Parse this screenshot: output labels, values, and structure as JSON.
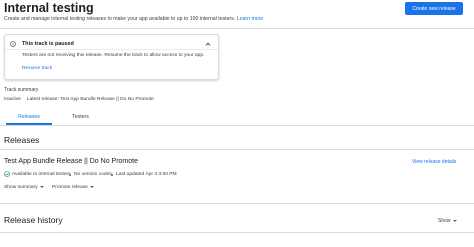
{
  "header": {
    "title": "Internal testing",
    "subtitle_text": "Create and manage internal testing releases to make your app available to up to 100 internal testers.",
    "subtitle_link": "Learn more",
    "primary_button": "Create new release"
  },
  "paused_card": {
    "title": "This track is paused",
    "body": "Testers are not receiving this release. Resume the track to allow access to your app.",
    "action": "Resume track"
  },
  "track_summary": {
    "label": "Track summary",
    "status": "Inactive",
    "latest_release": "Latest release: Test App Bundle Release || Do No Promote"
  },
  "tabs": [
    {
      "label": "Releases",
      "active": true
    },
    {
      "label": "Testers",
      "active": false
    }
  ],
  "releases": {
    "heading": "Releases",
    "release_title": "Test App Bundle Release || Do No Promote",
    "view_details": "View release details",
    "availability": "Available to internal testers",
    "version_codes": "No version codes",
    "last_updated": "Last updated Apr 4 3:50 PM",
    "show_summary": "Show summary",
    "promote": "Promote release"
  },
  "history": {
    "heading": "Release history",
    "show": "Show"
  },
  "colors": {
    "accent": "#1a73e8",
    "success": "#1e8e3e",
    "divider": "#dadce0"
  }
}
